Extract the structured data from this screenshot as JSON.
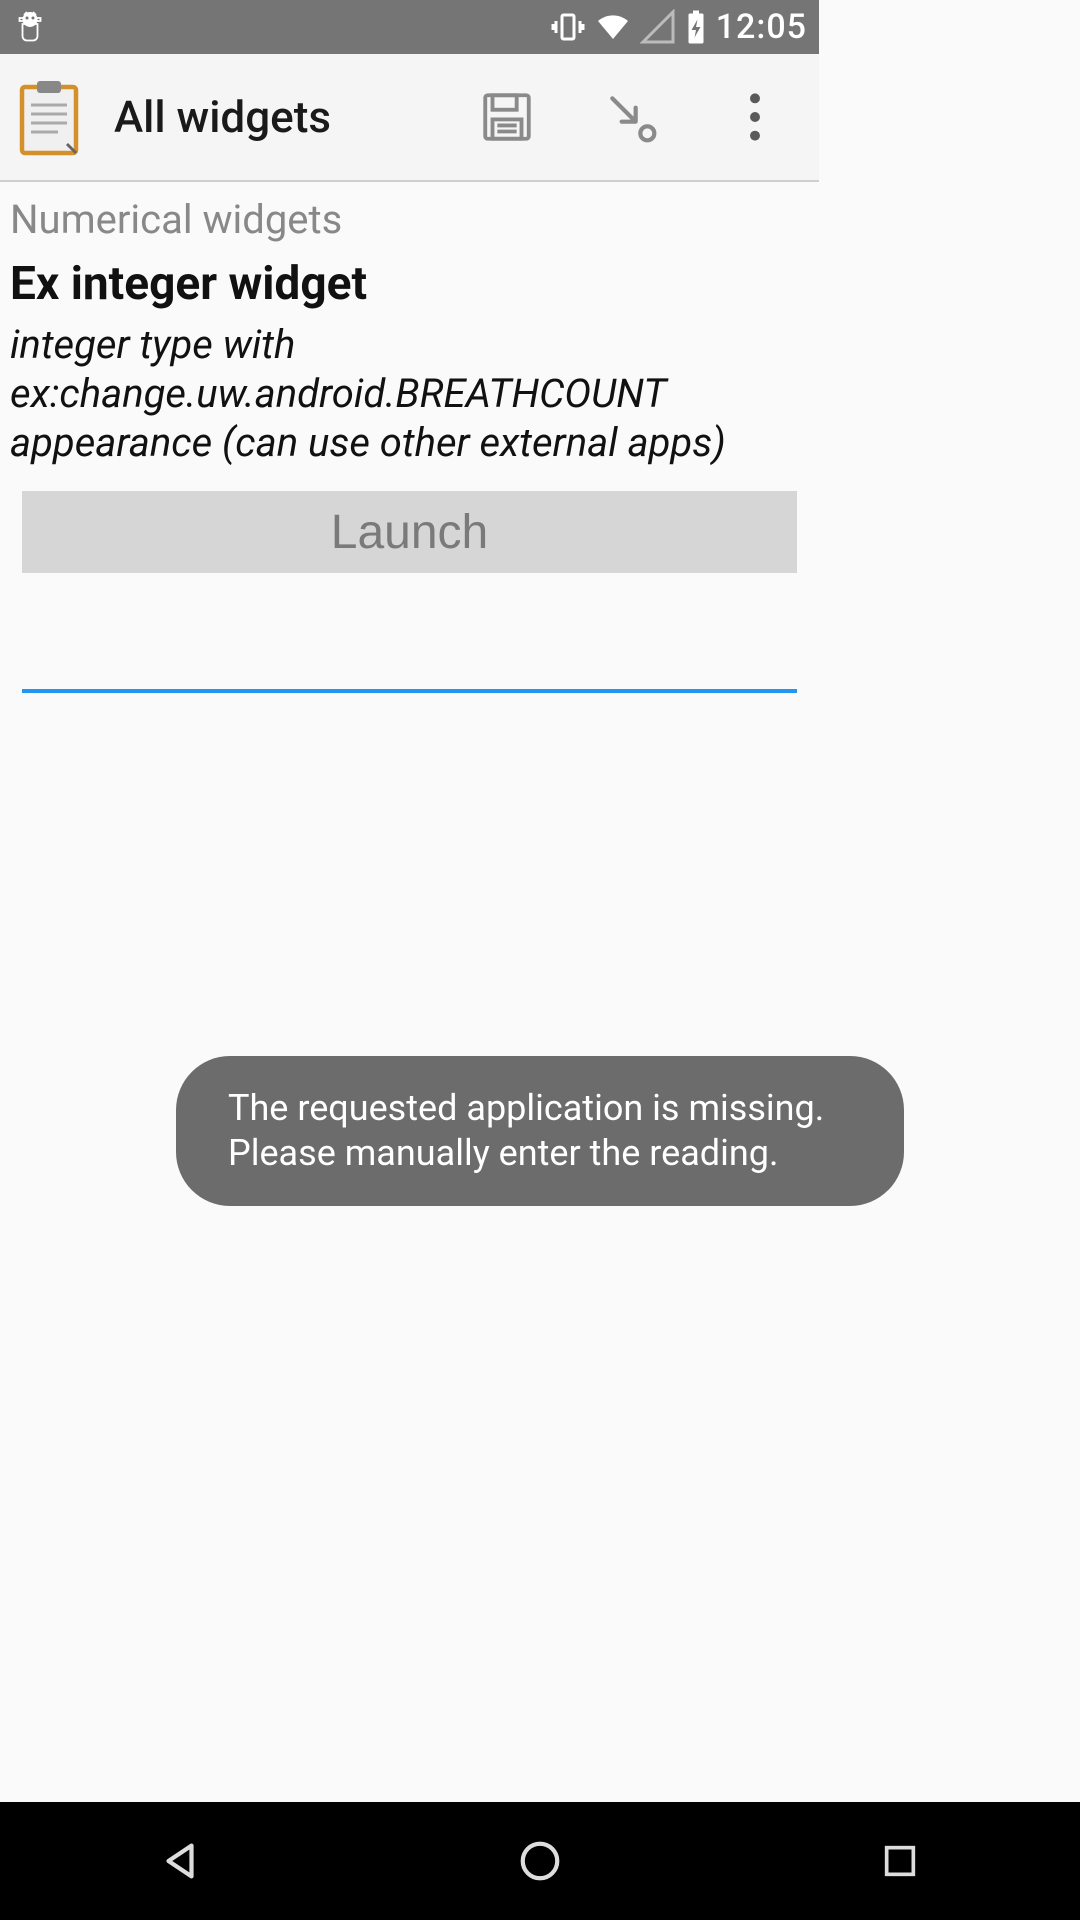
{
  "status_bar": {
    "time": "12:05"
  },
  "app_bar": {
    "title": "All widgets",
    "icon_name": "clipboard-icon",
    "save_icon": "floppy-disk-icon",
    "jump_icon": "arrow-to-point-icon",
    "overflow_icon": "more-vert-icon"
  },
  "content": {
    "section_header": "Numerical widgets",
    "widget_title": "Ex integer widget",
    "widget_desc": "integer type with ex:change.uw.android.BREATHCOUNT appearance (can use other external apps)",
    "launch_label": "Launch",
    "input_value": ""
  },
  "toast": {
    "message": "The requested application is missing. Please manually enter the reading."
  },
  "colors": {
    "accent": "#2196f3",
    "status_bg": "#757575",
    "toast_bg": "#6c6c6c",
    "launch_bg": "#d6d6d6",
    "launch_fg": "#7a7a7a"
  }
}
